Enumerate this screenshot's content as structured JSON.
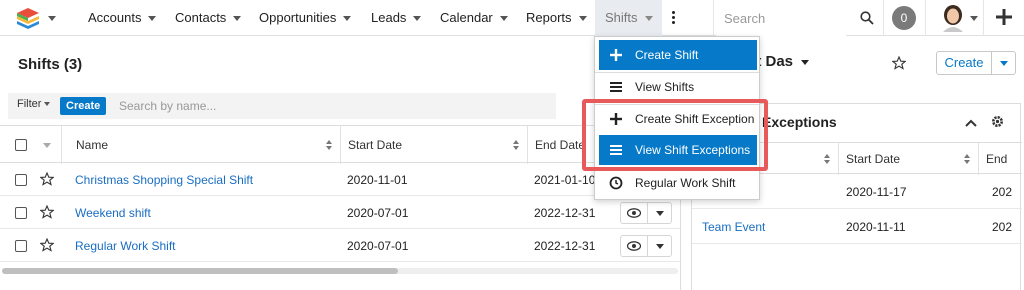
{
  "nav": {
    "items": [
      {
        "label": "Accounts"
      },
      {
        "label": "Contacts"
      },
      {
        "label": "Opportunities"
      },
      {
        "label": "Leads"
      },
      {
        "label": "Calendar"
      },
      {
        "label": "Reports"
      },
      {
        "label": "Shifts"
      }
    ],
    "search_placeholder": "Search",
    "notification_count": "0"
  },
  "list": {
    "title": "Shifts (3)",
    "filter_label": "Filter",
    "create_label": "Create",
    "search_placeholder": "Search by name...",
    "columns": [
      "Name",
      "Start Date",
      "End Date"
    ],
    "rows": [
      {
        "name": "Christmas Shopping Special Shift",
        "start": "2020-11-01",
        "end": "2021-01-10"
      },
      {
        "name": "Weekend shift",
        "start": "2020-07-01",
        "end": "2022-12-31"
      },
      {
        "name": "Regular Work Shift",
        "start": "2020-07-01",
        "end": "2022-12-31"
      }
    ]
  },
  "dashboard": {
    "title": "st Das",
    "create_label": "Create",
    "dashlet_title": "Exceptions",
    "columns": [
      "Start Date",
      "End"
    ],
    "rows": [
      {
        "name": "",
        "start": "2020-11-17",
        "end": "202"
      },
      {
        "name": "Team Event",
        "start": "2020-11-11",
        "end": "202"
      }
    ]
  },
  "menu": {
    "items": [
      {
        "label": "Create Shift",
        "icon": "plus-icon"
      },
      {
        "label": "View Shifts",
        "icon": "list-icon"
      },
      {
        "label": "Create Shift Exception",
        "icon": "plus-icon"
      },
      {
        "label": "View Shift Exceptions",
        "icon": "list-icon"
      },
      {
        "label": "Regular Work Shift",
        "icon": "clock-icon"
      }
    ]
  },
  "colors": {
    "accent": "#0679c8",
    "highlight_box": "#e8595a",
    "link": "#1a6ec2"
  }
}
